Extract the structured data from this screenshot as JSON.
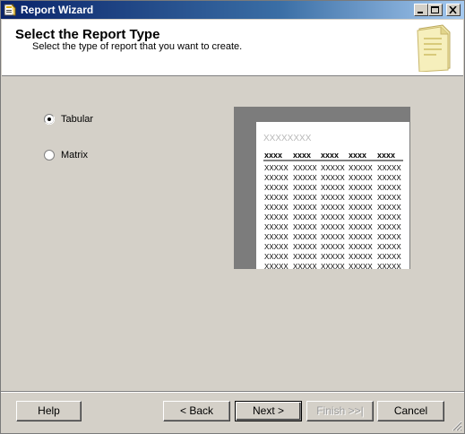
{
  "window": {
    "title": "Report Wizard",
    "controls": [
      "minimize-icon",
      "maximize-icon",
      "close-icon"
    ]
  },
  "header": {
    "title": "Select the Report Type",
    "subtitle": "Select the type of report that you want to create."
  },
  "options": [
    {
      "label": "Tabular",
      "selected": true
    },
    {
      "label": "Matrix",
      "selected": false
    }
  ],
  "preview": {
    "caption": "XXXXXXXX",
    "header_cells": [
      "xxxx",
      "xxxx",
      "xxxx",
      "xxxx",
      "xxxx"
    ],
    "cell_text": "XXXXX"
  },
  "buttons": {
    "help": "Help",
    "back": "< Back",
    "next": "Next >",
    "finish": "Finish >>|",
    "cancel": "Cancel"
  }
}
